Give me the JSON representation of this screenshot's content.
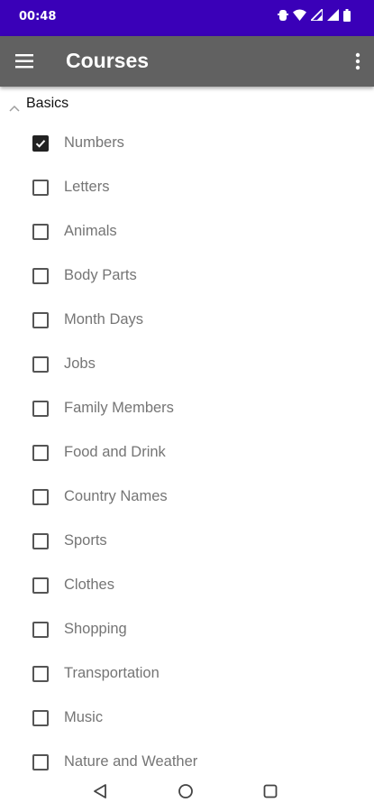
{
  "status_bar": {
    "time": "00:48",
    "icons": [
      "notification-icon",
      "wifi-icon",
      "signal-icon",
      "signal-icon",
      "battery-icon"
    ],
    "background": "#3a00b8"
  },
  "app_bar": {
    "title": "Courses",
    "background": "#616161",
    "left_icon": "menu-icon",
    "right_icon": "more-vert-icon"
  },
  "section": {
    "title": "Basics",
    "icon": "chevron-up-icon",
    "items": [
      {
        "label": "Numbers",
        "checked": true
      },
      {
        "label": "Letters",
        "checked": false
      },
      {
        "label": "Animals",
        "checked": false
      },
      {
        "label": "Body Parts",
        "checked": false
      },
      {
        "label": "Month Days",
        "checked": false
      },
      {
        "label": "Jobs",
        "checked": false
      },
      {
        "label": "Family Members",
        "checked": false
      },
      {
        "label": "Food and Drink",
        "checked": false
      },
      {
        "label": "Country Names",
        "checked": false
      },
      {
        "label": "Sports",
        "checked": false
      },
      {
        "label": "Clothes",
        "checked": false
      },
      {
        "label": "Shopping",
        "checked": false
      },
      {
        "label": "Transportation",
        "checked": false
      },
      {
        "label": "Music",
        "checked": false
      },
      {
        "label": "Nature and Weather",
        "checked": false
      }
    ]
  },
  "nav_bar": {
    "icons": [
      "back-icon",
      "home-icon",
      "recents-icon"
    ]
  }
}
